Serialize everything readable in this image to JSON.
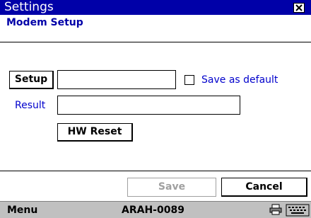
{
  "window": {
    "title": "Settings",
    "close_icon": "close-icon"
  },
  "page": {
    "subtitle": "Modem Setup"
  },
  "form": {
    "setup_button_label": "Setup",
    "setup_field_value": "",
    "save_default_label": "Save as default",
    "save_default_checked": false,
    "result_label": "Result",
    "result_field_value": "",
    "hw_reset_label": "HW Reset"
  },
  "actions": {
    "save_label": "Save",
    "save_enabled": false,
    "cancel_label": "Cancel"
  },
  "taskbar": {
    "menu_label": "Menu",
    "device_name": "ARAH-0089",
    "icons": [
      "printer-icon",
      "keyboard-icon"
    ]
  },
  "colors": {
    "title_bar": "#0000a8",
    "label_blue": "#0000cc",
    "disabled_text": "#a0a0a0",
    "taskbar": "#c0c0c0"
  }
}
